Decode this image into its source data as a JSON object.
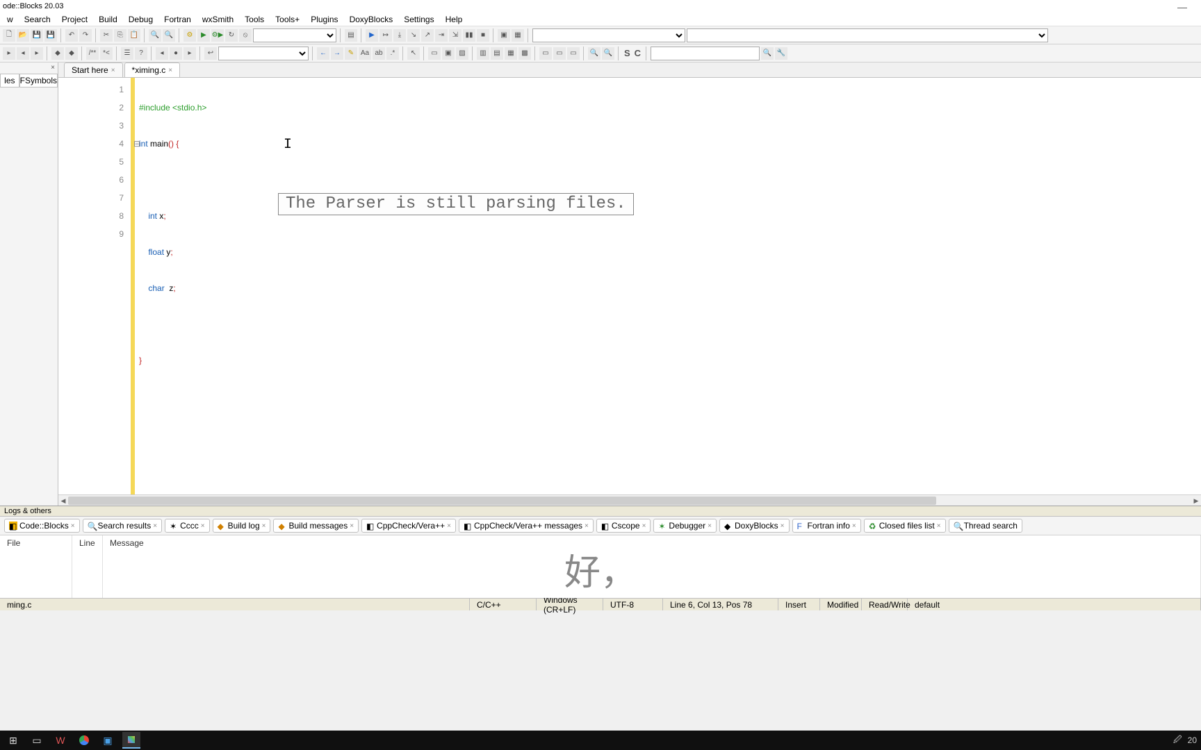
{
  "window": {
    "title": "ode::Blocks 20.03"
  },
  "menu": [
    "w",
    "Search",
    "Project",
    "Build",
    "Debug",
    "Fortran",
    "wxSmith",
    "Tools",
    "Tools+",
    "Plugins",
    "DoxyBlocks",
    "Settings",
    "Help"
  ],
  "side_tabs": {
    "t1": "les",
    "t2": "FSymbols"
  },
  "doc_tabs": [
    {
      "label": "Start here",
      "active": false
    },
    {
      "label": "*ximing.c",
      "active": true
    }
  ],
  "code": {
    "lines": [
      "1",
      "2",
      "3",
      "4",
      "5",
      "6",
      "7",
      "8",
      "9"
    ],
    "l1_pp": "#include <stdio.h>",
    "l2_kw": "int",
    "l2_fn": " main",
    "l2_paren": "()",
    "l2_brace": " {",
    "l4_kw": "int",
    "l4_rest": " x",
    "l4_semi": ";",
    "l5_kw": "float",
    "l5_rest": " y",
    "l5_semi": ";",
    "l6_kw": "char",
    "l6_rest": "  z",
    "l6_semi": ";",
    "l8_brace": "}",
    "tooltip": "The Parser is still parsing files."
  },
  "logs": {
    "title": "Logs & others",
    "tabs": [
      "Code::Blocks",
      "Search results",
      "Cccc",
      "Build log",
      "Build messages",
      "CppCheck/Vera++",
      "CppCheck/Vera++ messages",
      "Cscope",
      "Debugger",
      "DoxyBlocks",
      "Fortran info",
      "Closed files list",
      "Thread search"
    ],
    "headers": {
      "file": "File",
      "line": "Line",
      "message": "Message"
    }
  },
  "subtitle": "好，",
  "status": {
    "file": "ming.c",
    "lang": "C/C++",
    "eol": "Windows (CR+LF)",
    "enc": "UTF-8",
    "pos": "Line 6, Col 13, Pos 78",
    "ins": "Insert",
    "mod": "Modified",
    "rw": "Read/Write",
    "profile": "default"
  },
  "taskbar_right": "20"
}
